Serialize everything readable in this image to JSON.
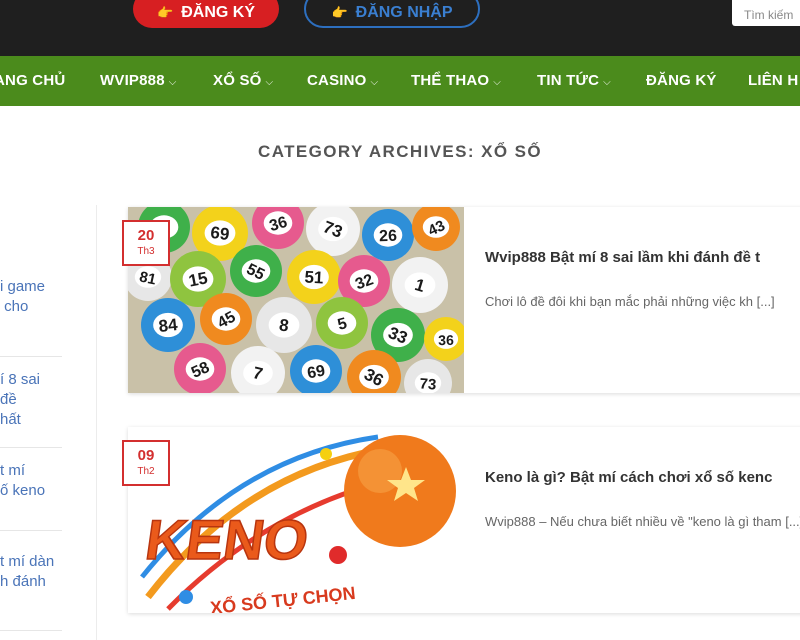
{
  "header": {
    "register_label": "ĐĂNG KÝ",
    "login_label": "ĐĂNG NHẬP",
    "search_placeholder": "Tìm kiếm"
  },
  "nav": {
    "items": [
      {
        "label": "ANG CHỦ",
        "has_dropdown": false
      },
      {
        "label": "WVIP888",
        "has_dropdown": true
      },
      {
        "label": "XỔ SỐ",
        "has_dropdown": true
      },
      {
        "label": "CASINO",
        "has_dropdown": true
      },
      {
        "label": "THỂ THAO",
        "has_dropdown": true
      },
      {
        "label": "TIN TỨC",
        "has_dropdown": true
      },
      {
        "label": "ĐĂNG KÝ",
        "has_dropdown": false
      },
      {
        "label": "LIÊN H",
        "has_dropdown": false
      }
    ]
  },
  "category_title": "CATEGORY ARCHIVES: XỔ SỐ",
  "sidebar": {
    "links": [
      "i game\n cho",
      "í 8 sai\nđề\nhất",
      "t mí\nố keno",
      "t mí dàn\nh đánh"
    ]
  },
  "posts": [
    {
      "day": "20",
      "month": "Th3",
      "title": "Wvip888 Bật mí 8 sai lầm khi đánh đề t",
      "excerpt": "Chơi lô đề đôi khi bạn mắc phải những việc kh [...]",
      "image": "lottery-balls-photo",
      "ball_numbers": [
        "7",
        "69",
        "36",
        "73",
        "26",
        "43",
        "81",
        "15",
        "55",
        "51",
        "32",
        "1",
        "84",
        "45",
        "8",
        "5",
        "33",
        "36",
        "58"
      ]
    },
    {
      "day": "09",
      "month": "Th2",
      "title": "Keno là gì? Bật mí cách chơi xổ số kenc",
      "excerpt": "Wvip888 – Nếu chưa biết nhiều về \"keno là gì tham [...]",
      "image": "keno-logo",
      "logo_text": "KENO",
      "logo_subtext": "XỔ SỐ TỰ CHỌN"
    }
  ],
  "colors": {
    "topbar": "#1f1f1f",
    "nav": "#4b8b1c",
    "accent_red": "#d32f2f",
    "link_blue": "#4a74b8"
  }
}
